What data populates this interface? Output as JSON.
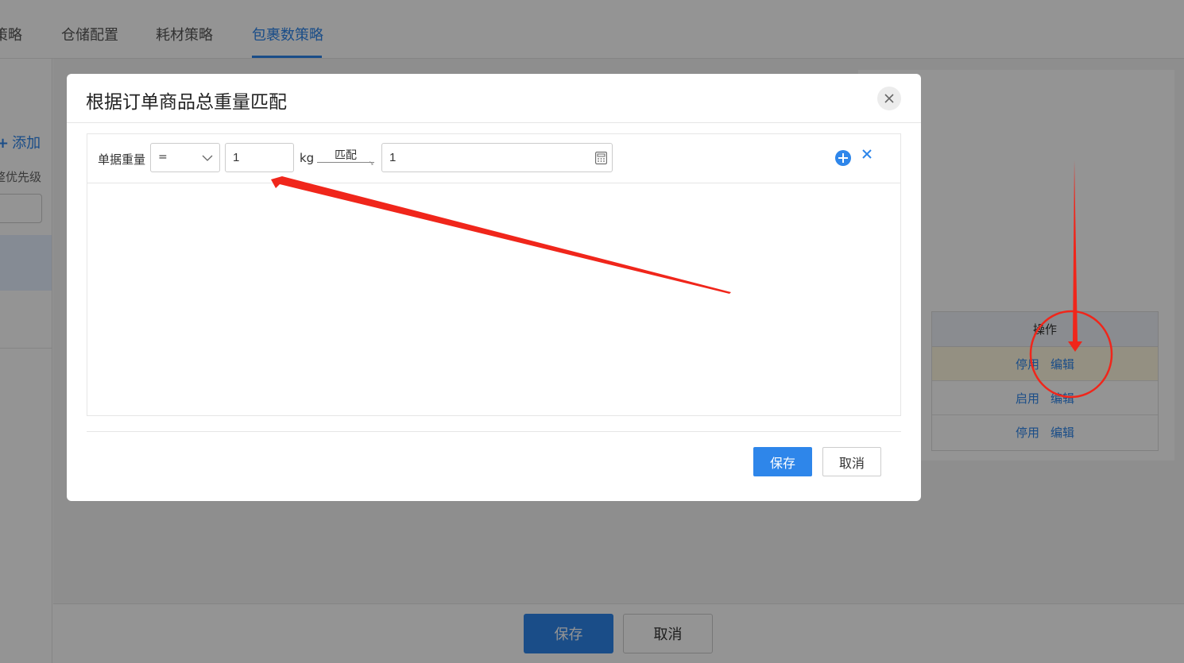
{
  "tabs": [
    {
      "label": "策略"
    },
    {
      "label": "仓储配置"
    },
    {
      "label": "耗材策略"
    },
    {
      "label": "包裹数策略"
    }
  ],
  "left": {
    "add_label": "添加",
    "priority_label": "整优先级"
  },
  "table": {
    "header_action": "操作",
    "rows": [
      {
        "toggle": "停用",
        "edit": "编辑"
      },
      {
        "toggle": "启用",
        "edit": "编辑"
      },
      {
        "toggle": "停用",
        "edit": "编辑"
      }
    ]
  },
  "bottom": {
    "save_label": "保存",
    "cancel_label": "取消"
  },
  "modal": {
    "title": "根据订单商品总重量匹配",
    "rule": {
      "field_label": "单据重量",
      "operator": "=",
      "weight_value": "1",
      "unit": "kg",
      "match_label": "匹配",
      "count_value": "1"
    },
    "save_label": "保存",
    "cancel_label": "取消"
  },
  "colors": {
    "primary": "#2e86ea",
    "annotation": "#f0261b"
  }
}
